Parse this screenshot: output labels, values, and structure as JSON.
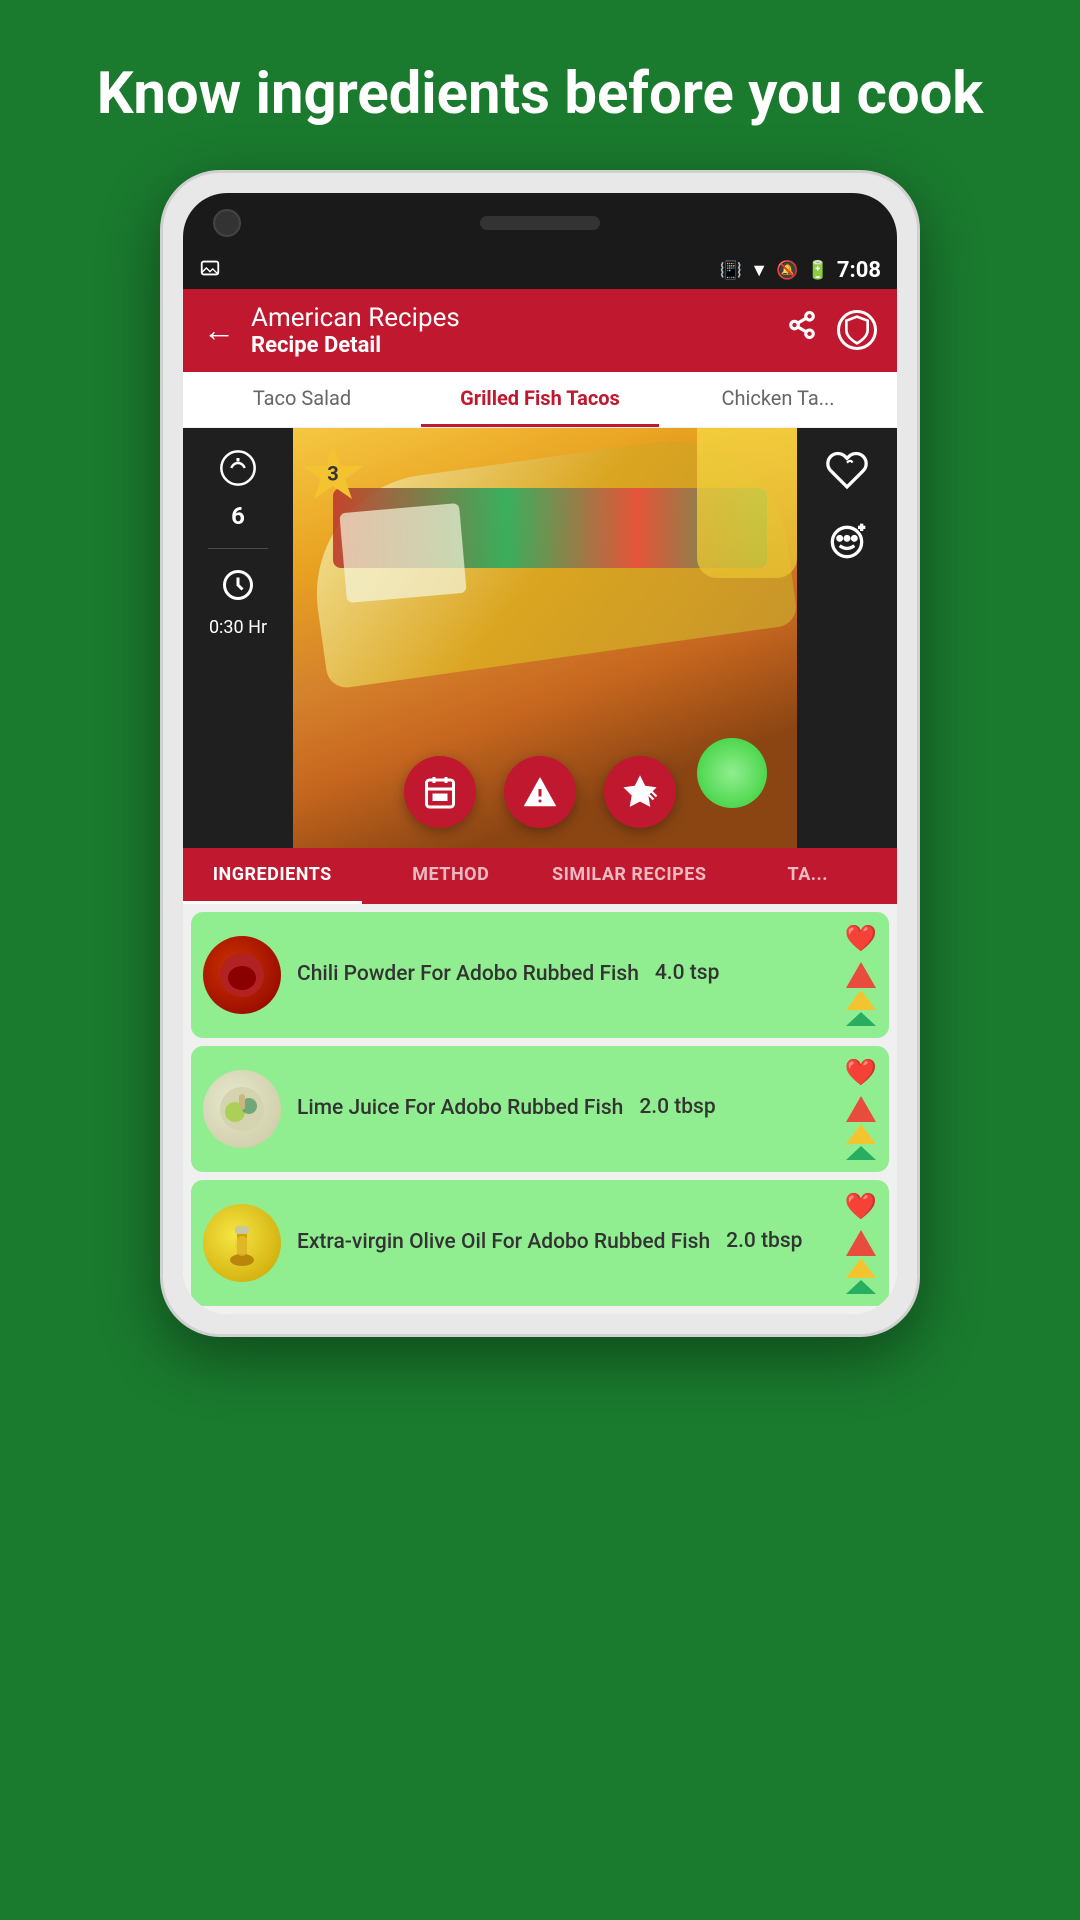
{
  "hero": {
    "title": "Know ingredients before you cook"
  },
  "status_bar": {
    "time": "7:08",
    "icons": [
      "vibrate",
      "wifi",
      "notification",
      "battery"
    ]
  },
  "app_bar": {
    "main_title": "American Recipes",
    "sub_title": "Recipe Detail",
    "back_label": "←",
    "share_label": "⇧",
    "shield_label": "FV"
  },
  "tabs": [
    {
      "label": "Taco Salad",
      "active": false
    },
    {
      "label": "Grilled Fish Tacos",
      "active": true
    },
    {
      "label": "Chicken Ta...",
      "active": false
    }
  ],
  "recipe": {
    "name": "Grilled Fish Tacos",
    "servings": "6",
    "time": "0:30 Hr",
    "star_count": "3"
  },
  "action_buttons": [
    {
      "icon": "📅",
      "label": "calendar-button"
    },
    {
      "icon": "△",
      "label": "alert-button"
    },
    {
      "icon": "★",
      "label": "favorite-edit-button"
    }
  ],
  "content_tabs": [
    {
      "label": "INGREDIENTS",
      "active": true
    },
    {
      "label": "METHOD",
      "active": false
    },
    {
      "label": "SIMILAR RECIPES",
      "active": false
    },
    {
      "label": "TA...",
      "active": false
    }
  ],
  "ingredients": [
    {
      "name": "Chili Powder For Adobo Rubbed Fish",
      "amount": "4.0 tsp",
      "image_type": "chili",
      "emoji": ""
    },
    {
      "name": "Lime Juice For Adobo Rubbed Fish",
      "amount": "2.0 tbsp",
      "image_type": "lime",
      "emoji": ""
    },
    {
      "name": "Extra-virgin Olive Oil For Adobo Rubbed Fish",
      "amount": "2.0 tbsp",
      "image_type": "olive-oil",
      "emoji": ""
    }
  ],
  "colors": {
    "primary": "#c0182e",
    "background": "#1a7a2e",
    "ingredient_bg": "#90ee90",
    "star_color": "#f4c430"
  }
}
